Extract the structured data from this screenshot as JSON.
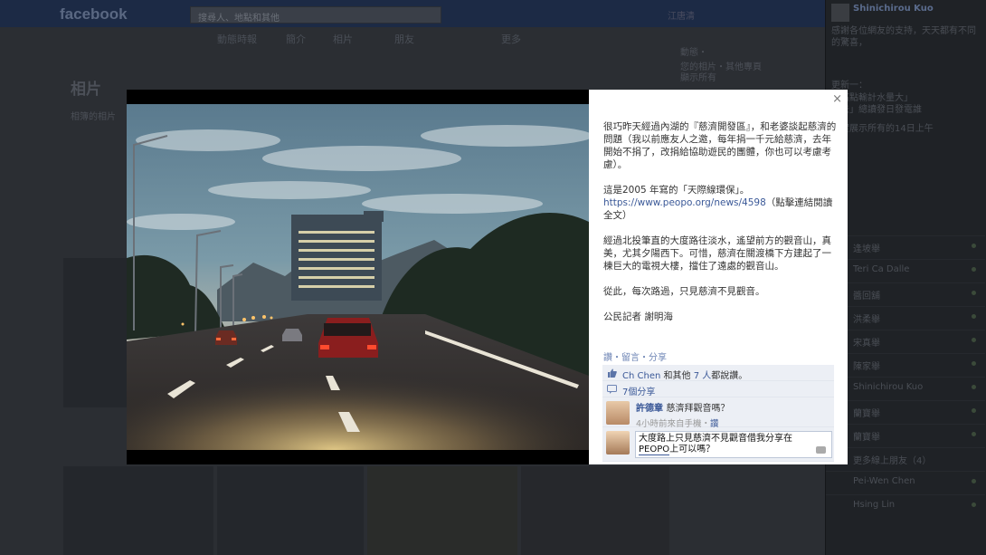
{
  "background": {
    "logo": "facebook",
    "search_placeholder": "搜尋人、地點和其他",
    "user_name": "江唐清",
    "nav": [
      "動態時報",
      "簡介",
      "相片",
      "朋友",
      "更多"
    ],
    "page_title": "相片",
    "page_sub": "相簿的相片",
    "side_lines": [
      "動態・",
      "您的相片・其他專頁",
      "顯示所有"
    ]
  },
  "ticker": {
    "name": "Shinichirou Kuo",
    "items": [
      "感謝各位網友的支持，天天都有不同的驚喜，",
      "更新一：",
      "「高點輸計水量大」",
      "「去」總讀發日發電誰",
      "事實展示所有的14日上午"
    ],
    "chat": [
      "逢坡舉",
      "Teri Ca Dalle",
      "醬回舖",
      "洪柔舉",
      "宋真舉",
      "陳家舉",
      "Shinichirou Kuo",
      "蘭寶舉",
      "蘭寶舉",
      "更多線上朋友（4）",
      "Pei-Wen Chen",
      "Hsing Lin"
    ]
  },
  "viewer": {
    "close_label": "×",
    "post_paragraphs": [
      "很巧昨天經過內湖的『慈濟開發區』，和老婆談起慈濟的問題（我以前應友人之邀，每年捐一千元給慈濟，去年開始不捐了，改捐給協助遊民的團體，你也可以考慮考慮）。",
      "這是2005 年寫的「天際線環保」。",
      "經過北投筆直的大度路往淡水，遙望前方的觀音山，真美，尤其夕陽西下。可惜，慈濟在關渡橋下方建起了一棟巨大的電視大樓，擋住了遠處的觀音山。",
      "從此，每次路過，只見慈濟不見觀音。",
      "公民記者 謝明海"
    ],
    "link_url": "https://www.peopo.org/news/4598",
    "link_suffix": "（點擊連結閱讀全文）",
    "actions": "讚・留言・分享",
    "likes_names": "Ch Chen",
    "likes_rest": "和其他",
    "likes_count": "7 人",
    "likes_suffix": "都說讚。",
    "shares": "7個分享",
    "comment_author": "許德章",
    "comment_text": "慈濟拜觀音嗎？",
    "comment_meta": "4小時前來自手機・",
    "comment_like": "讚",
    "reply_line1": "大度路上只見慈濟不見觀音借我分享在",
    "reply_peopo": "PEOPO",
    "reply_line2": "上可以嗎？"
  }
}
